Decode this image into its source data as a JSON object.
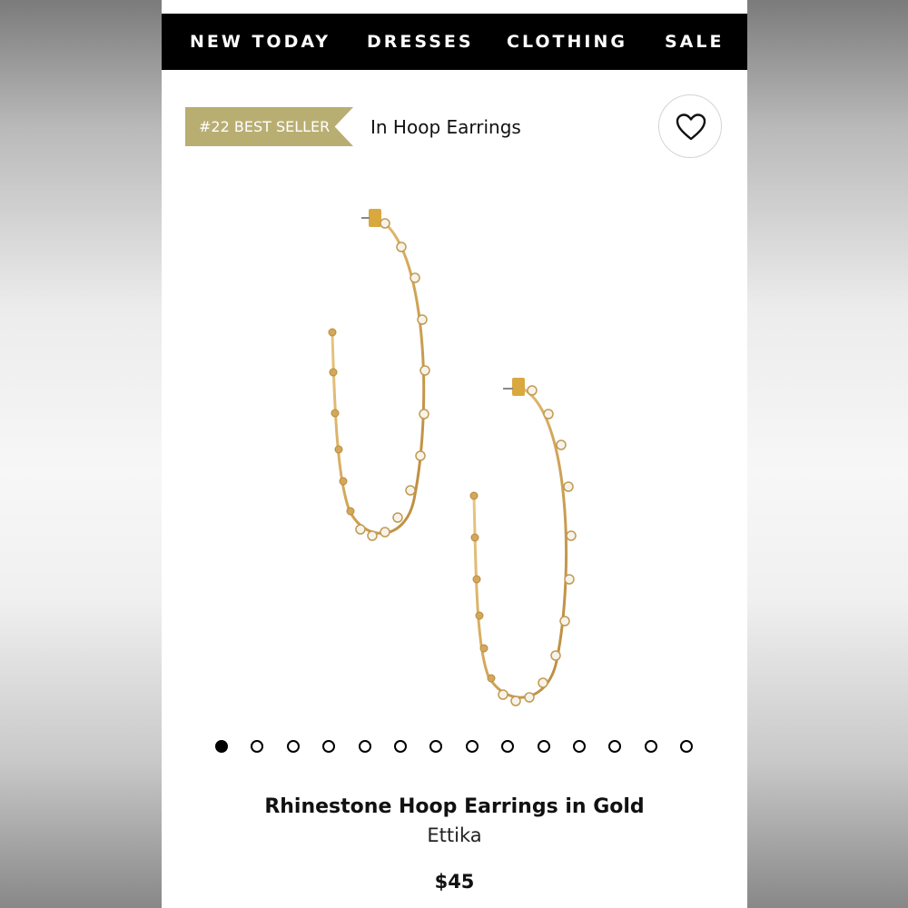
{
  "nav": {
    "items": [
      {
        "label": "NEW TODAY"
      },
      {
        "label": "DRESSES"
      },
      {
        "label": "CLOTHING"
      },
      {
        "label": "SALE"
      }
    ]
  },
  "badge": {
    "label": "#22 BEST SELLER"
  },
  "category": {
    "label": "In Hoop Earrings"
  },
  "wishlist": {
    "icon": "heart-outline-icon"
  },
  "gallery": {
    "image_count": 14,
    "active_index": 0
  },
  "product": {
    "title": "Rhinestone Hoop Earrings in Gold",
    "brand": "Ettika",
    "price": "$45"
  },
  "colors": {
    "nav_background": "#000000",
    "badge_gold": "#b9ae72",
    "gold_metal": "#d9b46a"
  }
}
